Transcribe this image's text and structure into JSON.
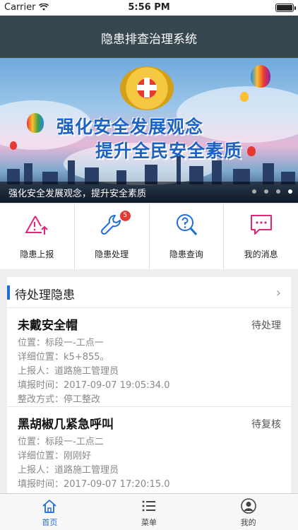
{
  "status_bar": {
    "carrier": "Carrier",
    "time": "5:56 PM"
  },
  "app": {
    "title": "隐患排查治理系统"
  },
  "banner": {
    "slogan_line1": "强化安全发展观念",
    "slogan_line2": "提升全民安全素质",
    "caption": "强化安全发展观念，提升安全素质",
    "dot_count": 4,
    "active_dot": 3
  },
  "quick_menu": [
    {
      "label": "隐患上报",
      "icon": "warning-upload-icon",
      "color": "#e0257a"
    },
    {
      "label": "隐患处理",
      "icon": "wrench-icon",
      "color": "#1e6fd9",
      "badge": "5"
    },
    {
      "label": "隐患查询",
      "icon": "search-question-icon",
      "color": "#1e6fd9"
    },
    {
      "label": "我的消息",
      "icon": "message-icon",
      "color": "#e0257a"
    }
  ],
  "pending": {
    "title": "待处理隐患",
    "items": [
      {
        "title": "未戴安全帽",
        "status": "待处理",
        "location": "位置：标段一-工点一",
        "detail_location": "详细位置：k5+855。",
        "reporter": "上报人：道路施工管理员",
        "report_time": "填报时间：2017-09-07 19:05:34.0",
        "rectify_method": "整改方式：停工整改"
      },
      {
        "title": "黑胡椒几紧急呼叫",
        "status": "待复核",
        "location": "位置：标段一-工点二",
        "detail_location": "详细位置：刚刚好",
        "reporter": "上报人：道路施工管理员",
        "report_time": "填报时间：2017-09-07 17:20:15.0"
      }
    ]
  },
  "tabbar": [
    {
      "label": "首页",
      "icon": "home-icon",
      "active": true
    },
    {
      "label": "菜单",
      "icon": "menu-list-icon",
      "active": false
    },
    {
      "label": "我的",
      "icon": "profile-icon",
      "active": false
    }
  ],
  "colors": {
    "nav": "#37474f",
    "accent": "#1e6fd9",
    "pink": "#e0257a",
    "badge": "#e53935"
  }
}
